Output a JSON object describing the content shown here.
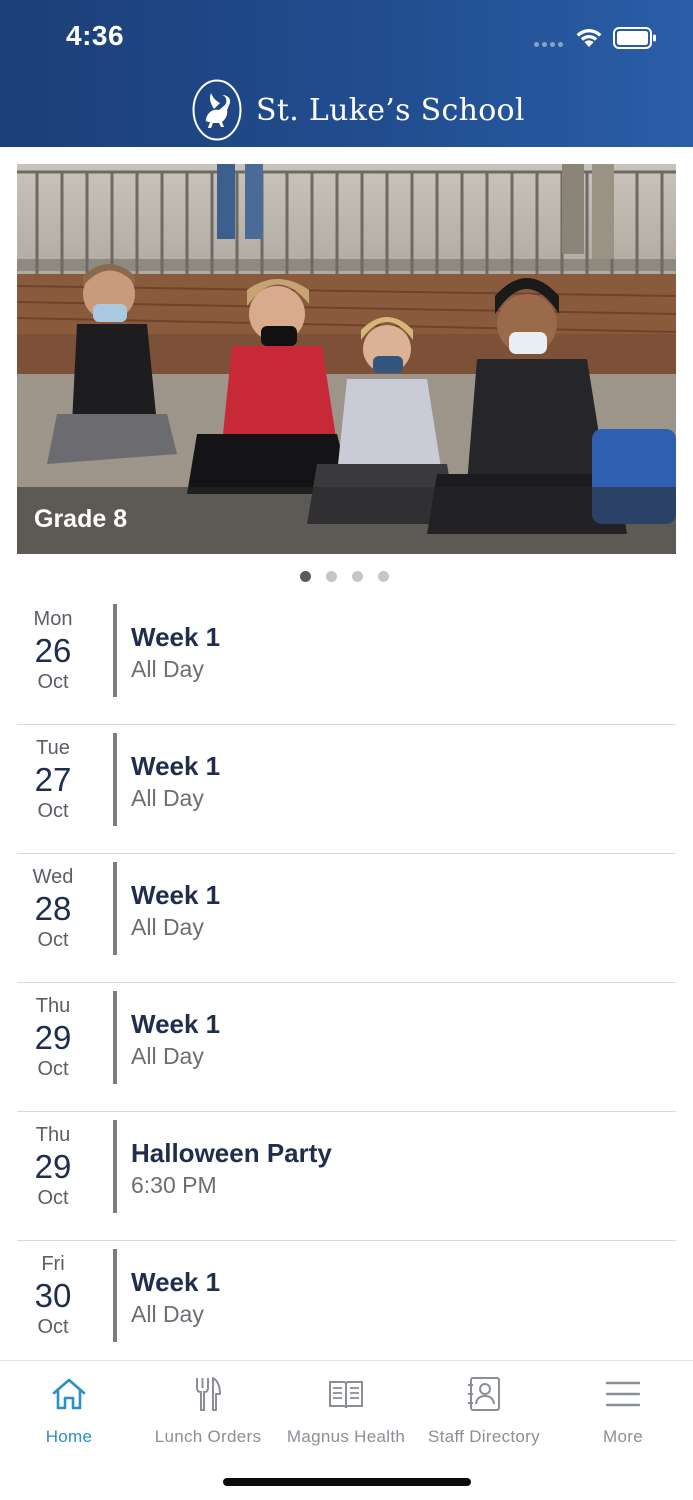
{
  "status_bar": {
    "time": "4:36"
  },
  "header": {
    "school_name": "St. Luke’s School",
    "logo_icon": "pegasus-logo-icon"
  },
  "hero": {
    "caption": "Grade 8",
    "slide_count": 4,
    "active_slide": 1
  },
  "events": [
    {
      "dow": "Mon",
      "day": "26",
      "month": "Oct",
      "title": "Week 1",
      "time": "All Day"
    },
    {
      "dow": "Tue",
      "day": "27",
      "month": "Oct",
      "title": "Week 1",
      "time": "All Day"
    },
    {
      "dow": "Wed",
      "day": "28",
      "month": "Oct",
      "title": "Week 1",
      "time": "All Day"
    },
    {
      "dow": "Thu",
      "day": "29",
      "month": "Oct",
      "title": "Week 1",
      "time": "All Day"
    },
    {
      "dow": "Thu",
      "day": "29",
      "month": "Oct",
      "title": "Halloween Party",
      "time": "6:30 PM"
    },
    {
      "dow": "Fri",
      "day": "30",
      "month": "Oct",
      "title": "Week 1",
      "time": "All Day"
    }
  ],
  "tabs": [
    {
      "label": "Home",
      "icon": "home-icon",
      "active": true
    },
    {
      "label": "Lunch Orders",
      "icon": "utensils-icon",
      "active": false
    },
    {
      "label": "Magnus Health",
      "icon": "book-icon",
      "active": false
    },
    {
      "label": "Staff Directory",
      "icon": "contact-card-icon",
      "active": false
    },
    {
      "label": "More",
      "icon": "menu-icon",
      "active": false
    }
  ],
  "colors": {
    "header": "#214d8f",
    "accent": "#2a8fc6",
    "text_primary": "#1f2e4d",
    "text_secondary": "#6b6f75"
  }
}
